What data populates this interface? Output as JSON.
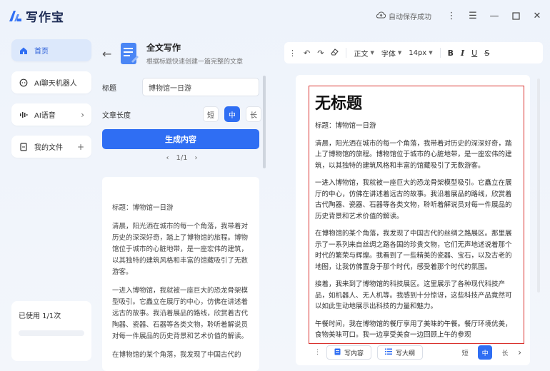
{
  "app": {
    "name": "写作宝",
    "autosave": "自动保存成功"
  },
  "nav": {
    "items": [
      {
        "label": "首页",
        "icon": "home-icon",
        "active": true,
        "trail": ""
      },
      {
        "label": "AI聊天机器人",
        "icon": "chat-icon",
        "active": false,
        "trail": ""
      },
      {
        "label": "AI语音",
        "icon": "audio-icon",
        "active": false,
        "trail": "›"
      },
      {
        "label": "我的文件",
        "icon": "file-icon",
        "active": false,
        "trail": "+"
      }
    ],
    "usage": "已使用 1/1次"
  },
  "panel": {
    "title": "全文写作",
    "subtitle": "根据标题快速创建一篇完整的文章",
    "title_label": "标题",
    "title_value": "博物馆一日游",
    "length_label": "文章长度",
    "length_options": [
      "短",
      "中",
      "长"
    ],
    "length_selected": "中",
    "generate_label": "生成内容",
    "pager": "1/1",
    "result": [
      "标题：博物馆一日游",
      "清晨，阳光洒在城市的每一个角落，我带着对历史的深深好奇，踏上了博物馆的旅程。博物馆位于城市的心脏地带，是一座宏伟的建筑，以其独特的建筑风格和丰富的馆藏吸引了无数游客。",
      "一进入博物馆，我就被一座巨大的恐龙骨架模型吸引。它矗立在展厅的中心，仿佛在讲述着远古的故事。我沿着展品的路线，欣赏着古代陶器、瓷器、石器等各类文物，聆听着解说员对每一件展品的历史背景和艺术价值的解读。",
      "在博物馆的某个角落，我发现了中国古代的"
    ]
  },
  "toolbar": {
    "paragraph": "正文",
    "font": "字体",
    "size": "14px",
    "bold": "B",
    "italic": "I",
    "underline": "U",
    "strike": "S"
  },
  "document": {
    "title": "无标题",
    "paragraphs": [
      "标题：博物馆一日游",
      "清晨，阳光洒在城市的每一个角落，我带着对历史的深深好奇，踏上了博物馆的旅程。博物馆位于城市的心脏地带，是一座宏伟的建筑，以其独特的建筑风格和丰富的馆藏吸引了无数游客。",
      "一进入博物馆，我就被一座巨大的恐龙骨架模型吸引。它矗立在展厅的中心，仿佛在讲述着远古的故事。我沿着展品的路线，欣赏着古代陶器、瓷器、石器等各类文物，聆听着解说员对每一件展品的历史背景和艺术价值的解读。",
      "在博物馆的某个角落，我发现了中国古代的丝绸之路展区。那里展示了一系列来自丝绸之路各国的珍贵文物，它们无声地述说着那个时代的繁荣与辉煌。我看到了一些精美的瓷器、宝石，以及古老的地图，让我仿佛置身于那个时代，感受着那个时代的氛围。",
      "接着，我来到了博物馆的科技展区。这里展示了各种现代科技产品，如机器人、无人机等。我感到十分惊讶，这些科技产品竟然可以如此生动地展示出科技的力量和魅力。",
      "午餐时间，我在博物馆的餐厅享用了美味的午餐。餐厅环境优美，食物美味可口。我一边享受美食一边回顾上午的参观"
    ]
  },
  "bottom": {
    "write_content": "写内容",
    "write_outline": "写大纲",
    "lengths": [
      "短",
      "中",
      "长"
    ],
    "length_selected": "中"
  },
  "colors": {
    "accent": "#2f6ef3",
    "frame": "#d9302c"
  }
}
